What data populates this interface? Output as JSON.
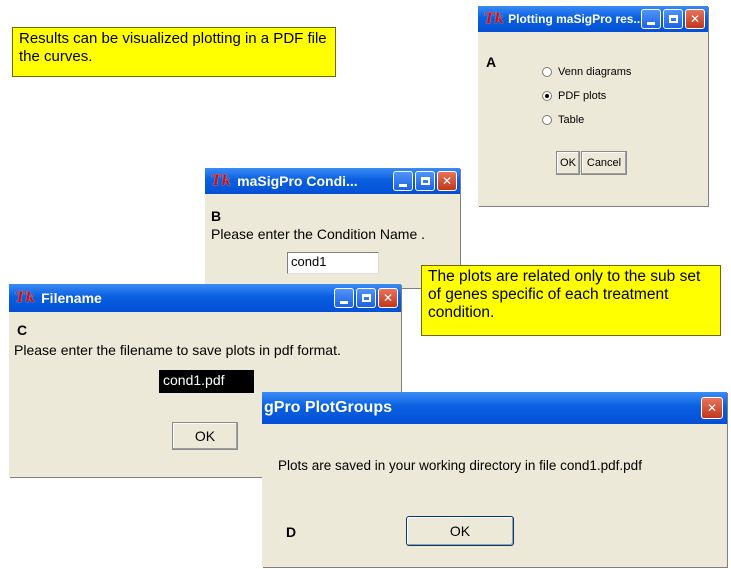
{
  "notes": {
    "top": "Results can be visualized plotting in a PDF file the curves.",
    "right": "The plots are related only to the sub set of genes specific of each treatment condition."
  },
  "dialog_a": {
    "title": "Plotting maSigPro res...",
    "label": "A",
    "options": [
      {
        "label": "Venn diagrams",
        "selected": false
      },
      {
        "label": "PDF plots",
        "selected": true
      },
      {
        "label": "Table",
        "selected": false
      }
    ],
    "ok": "OK",
    "cancel": "Cancel"
  },
  "dialog_b": {
    "title": "maSigPro Condi...",
    "label": "B",
    "prompt": "Please enter the Condition Name .",
    "value": "cond1"
  },
  "dialog_c": {
    "title": "Filename",
    "label": "C",
    "prompt": "Please enter the filename to save plots in pdf format.",
    "value": "cond1.pdf",
    "ok": "OK"
  },
  "dialog_d": {
    "title": "gPro PlotGroups",
    "label": "D",
    "message": "Plots are saved in your working directory in file cond1.pdf.pdf",
    "ok": "OK"
  },
  "colors": {
    "note_bg": "#ffff00",
    "titlebar": "#0a5fe0",
    "dialog_bg": "#ece9d8",
    "close_button": "#c0371c"
  }
}
